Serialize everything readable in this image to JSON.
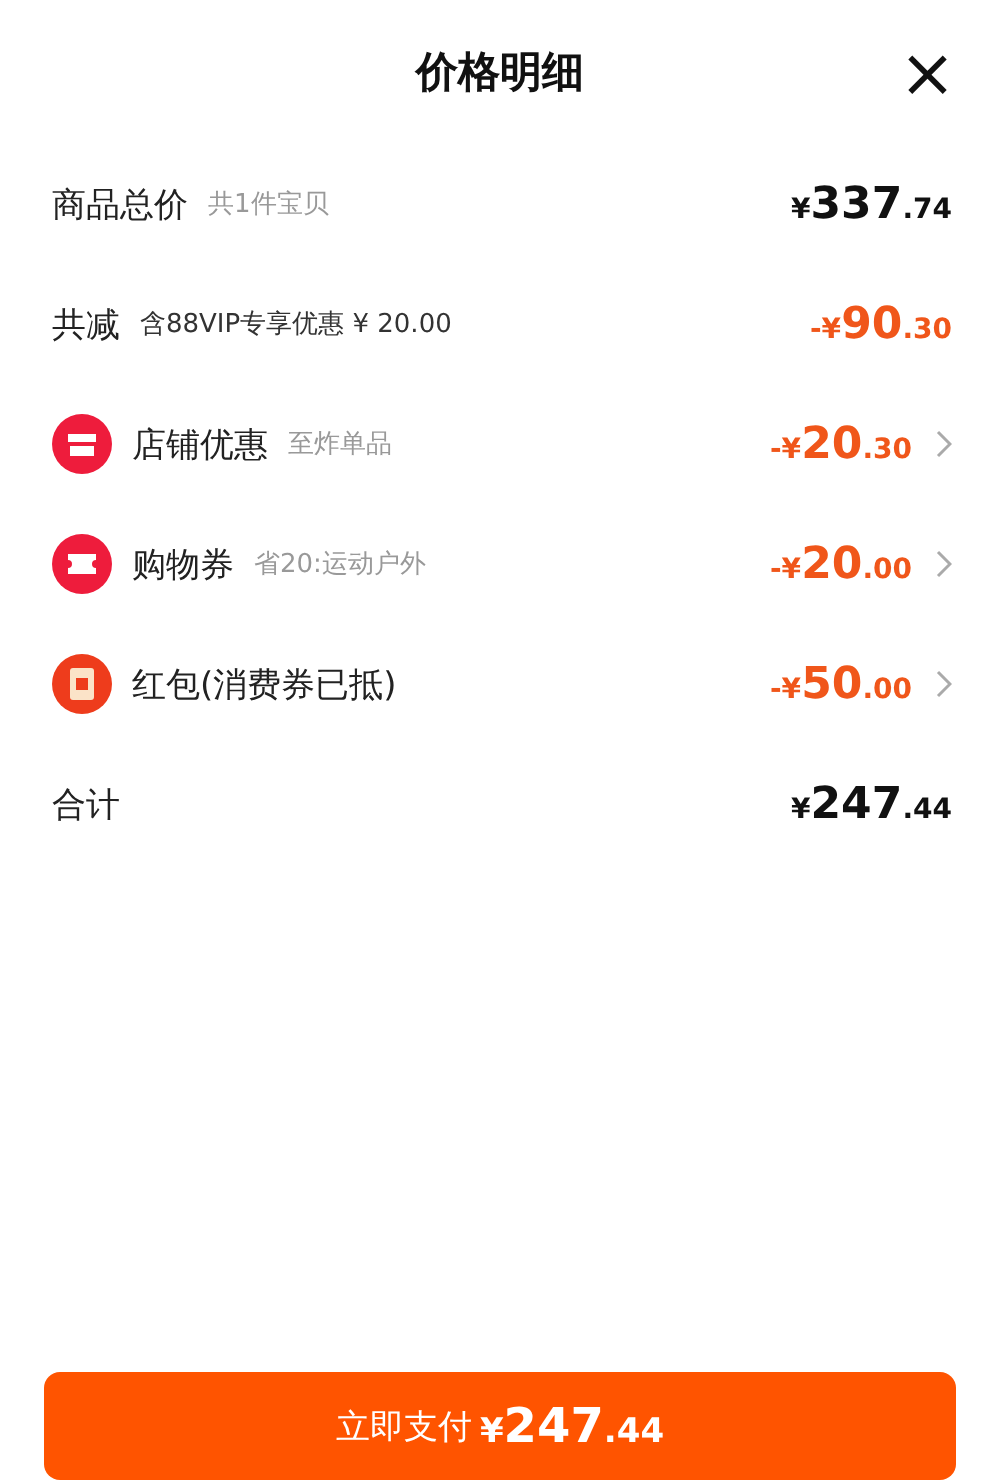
{
  "header": {
    "title": "价格明细",
    "close": "×"
  },
  "rows": [
    {
      "kind": "plain",
      "label": "商品总价",
      "note": "共1件宝贝",
      "deduction": false,
      "amount": {
        "prefix": "¥",
        "whole": "337",
        "fraction": ".74"
      }
    },
    {
      "kind": "plain",
      "label": "共减",
      "note": "含88VIP专享优惠 ¥ 20.00",
      "note_dark": true,
      "deduction": true,
      "amount": {
        "prefix": "-¥",
        "whole": "90",
        "fraction": ".30"
      }
    },
    {
      "kind": "shop",
      "label": "店铺优惠",
      "note": "至炸单品",
      "deduction": true,
      "amount": {
        "prefix": "-¥",
        "whole": "20",
        "fraction": ".30"
      }
    },
    {
      "kind": "ticket",
      "label": "购物券",
      "note": "省20:运动户外",
      "deduction": true,
      "amount": {
        "prefix": "-¥",
        "whole": "20",
        "fraction": ".00"
      }
    },
    {
      "kind": "envelope",
      "label": "红包(消费券已抵)",
      "deduction": true,
      "amount": {
        "prefix": "-¥",
        "whole": "50",
        "fraction": ".00"
      }
    },
    {
      "kind": "plain",
      "label": "合计",
      "deduction": false,
      "amount": {
        "prefix": "¥",
        "whole": "247",
        "fraction": ".44"
      }
    }
  ],
  "pay_button": {
    "label": "立即支付",
    "amount": {
      "prefix": "¥",
      "whole": "247",
      "fraction": ".44"
    }
  }
}
